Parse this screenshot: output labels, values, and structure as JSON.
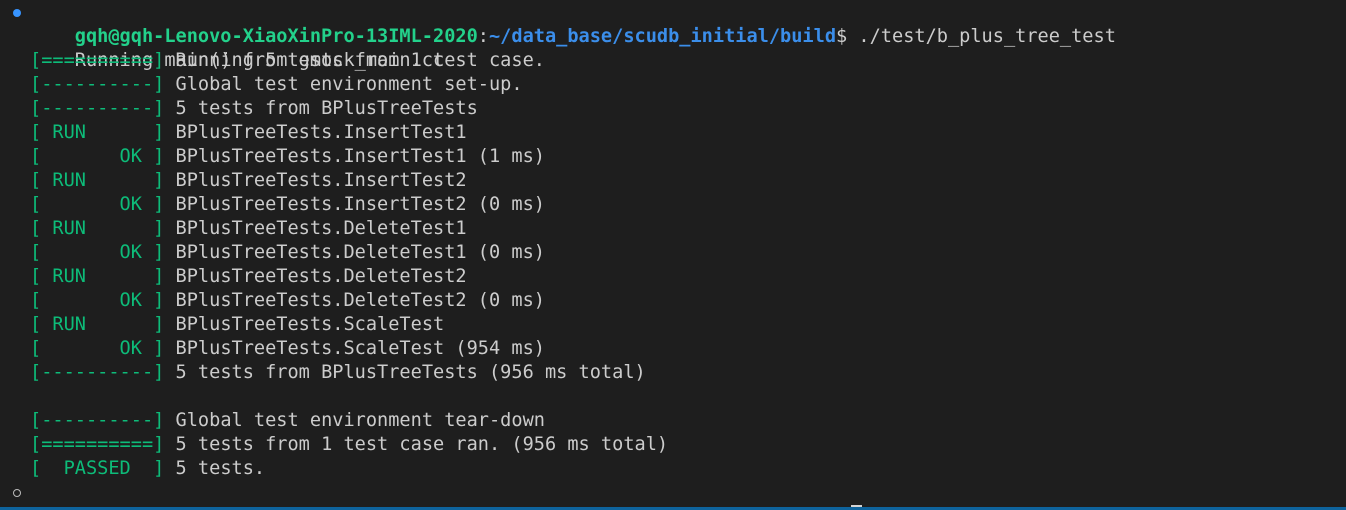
{
  "prompt": {
    "user_host": "gqh@gqh-Lenovo-XiaoXinPro-13IML-2020",
    "separator": ":",
    "path": "~/data_base/scudb_initial/build",
    "dollar": "$",
    "command": " ./test/b_plus_tree_test"
  },
  "output": {
    "intro": "Running main() from gmock_main.cc",
    "lines": [
      {
        "tag": "[==========]",
        "text": " Running 5 tests from 1 test case."
      },
      {
        "tag": "[----------]",
        "text": " Global test environment set-up."
      },
      {
        "tag": "[----------]",
        "text": " 5 tests from BPlusTreeTests"
      },
      {
        "tag": "[ RUN      ]",
        "text": " BPlusTreeTests.InsertTest1"
      },
      {
        "tag": "[       OK ]",
        "text": " BPlusTreeTests.InsertTest1 (1 ms)"
      },
      {
        "tag": "[ RUN      ]",
        "text": " BPlusTreeTests.InsertTest2"
      },
      {
        "tag": "[       OK ]",
        "text": " BPlusTreeTests.InsertTest2 (0 ms)"
      },
      {
        "tag": "[ RUN      ]",
        "text": " BPlusTreeTests.DeleteTest1"
      },
      {
        "tag": "[       OK ]",
        "text": " BPlusTreeTests.DeleteTest1 (0 ms)"
      },
      {
        "tag": "[ RUN      ]",
        "text": " BPlusTreeTests.DeleteTest2"
      },
      {
        "tag": "[       OK ]",
        "text": " BPlusTreeTests.DeleteTest2 (0 ms)"
      },
      {
        "tag": "[ RUN      ]",
        "text": " BPlusTreeTests.ScaleTest"
      },
      {
        "tag": "[       OK ]",
        "text": " BPlusTreeTests.ScaleTest (954 ms)"
      },
      {
        "tag": "[----------]",
        "text": " 5 tests from BPlusTreeTests (956 ms total)"
      },
      {
        "tag": "[----------]",
        "text": " Global test environment tear-down"
      },
      {
        "tag": "[==========]",
        "text": " 5 tests from 1 test case ran. (956 ms total)"
      },
      {
        "tag": "[  PASSED  ]",
        "text": " 5 tests."
      }
    ]
  },
  "colors": {
    "background": "#1e1e1e",
    "user_host": "#23d18b",
    "path": "#3b8eea",
    "gtest_tag": "#0dbc79",
    "text": "#cccccc"
  }
}
